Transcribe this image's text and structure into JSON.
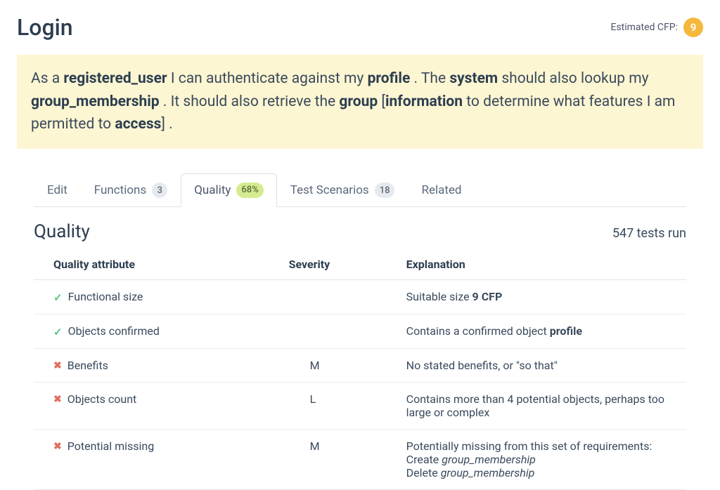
{
  "header": {
    "title": "Login",
    "cfp_label": "Estimated CFP:",
    "cfp_value": "9"
  },
  "story": {
    "parts": [
      {
        "t": "As a ",
        "b": false
      },
      {
        "t": "registered_user",
        "b": true
      },
      {
        "t": " I can authenticate against my ",
        "b": false
      },
      {
        "t": "profile",
        "b": true
      },
      {
        "t": " . The ",
        "b": false
      },
      {
        "t": "system",
        "b": true
      },
      {
        "t": " should also lookup my ",
        "b": false
      },
      {
        "t": "group_membership",
        "b": true
      },
      {
        "t": " . It should also retrieve the ",
        "b": false
      },
      {
        "t": "group",
        "b": true
      },
      {
        "t": " [",
        "b": false
      },
      {
        "t": "information",
        "b": true
      },
      {
        "t": " to determine what features I am permitted to ",
        "b": false
      },
      {
        "t": "access",
        "b": true
      },
      {
        "t": "] .",
        "b": false
      }
    ]
  },
  "tabs": [
    {
      "label": "Edit",
      "badge": null,
      "badge_class": "",
      "active": false
    },
    {
      "label": "Functions",
      "badge": "3",
      "badge_class": "",
      "active": false
    },
    {
      "label": "Quality",
      "badge": "68%",
      "badge_class": "green",
      "active": true
    },
    {
      "label": "Test Scenarios",
      "badge": "18",
      "badge_class": "",
      "active": false
    },
    {
      "label": "Related",
      "badge": null,
      "badge_class": "",
      "active": false
    }
  ],
  "quality": {
    "section_title": "Quality",
    "tests_run": "547 tests run",
    "columns": {
      "attr": "Quality attribute",
      "sev": "Severity",
      "exp": "Explanation"
    },
    "rows": [
      {
        "status": "pass",
        "attribute": "Functional size",
        "severity": "",
        "explanation_html": "Suitable size <b>9 CFP</b>"
      },
      {
        "status": "pass",
        "attribute": "Objects confirmed",
        "severity": "",
        "explanation_html": "Contains a confirmed object <b>profile</b>"
      },
      {
        "status": "fail",
        "attribute": "Benefits",
        "severity": "M",
        "explanation_html": "No stated benefits, or \"so that\""
      },
      {
        "status": "fail",
        "attribute": "Objects count",
        "severity": "L",
        "explanation_html": "Contains more than 4 potential objects, perhaps too large or complex"
      },
      {
        "status": "fail",
        "attribute": "Potential missing",
        "severity": "M",
        "explanation_html": "Potentially missing from this set of requirements:<br>Create <i>group_membership</i><br>Delete <i>group_membership</i>"
      }
    ]
  }
}
